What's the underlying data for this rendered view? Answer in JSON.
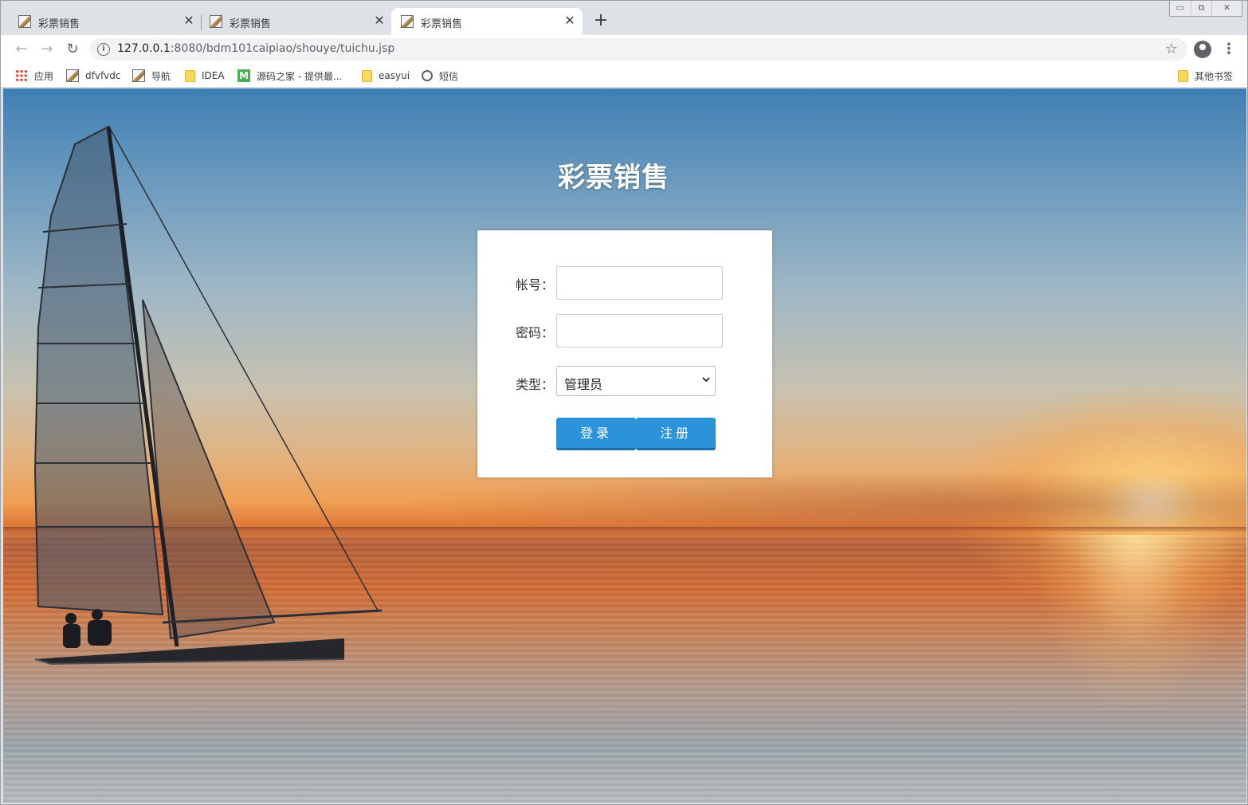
{
  "browser": {
    "tabs": [
      {
        "title": "彩票销售",
        "active": false
      },
      {
        "title": "彩票销售",
        "active": false
      },
      {
        "title": "彩票销售",
        "active": true
      }
    ],
    "url_host": "127.0.0.1",
    "url_path": ":8080/bdm101caipiao/shouye/tuichu.jsp",
    "bookmarks": [
      {
        "label": "应用",
        "icon": "apps-icon"
      },
      {
        "label": "dfvfvdc",
        "icon": "page-icon"
      },
      {
        "label": "导航",
        "icon": "page-icon"
      },
      {
        "label": "IDEA",
        "icon": "folder-icon"
      },
      {
        "label": "源码之家 - 提供最...",
        "icon": "m-logo-icon"
      },
      {
        "label": "easyui",
        "icon": "folder-icon"
      },
      {
        "label": "短信",
        "icon": "globe-icon"
      }
    ],
    "other_bookmarks": "其他书签"
  },
  "page": {
    "title": "彩票销售",
    "form": {
      "account_label": "帐号：",
      "account_value": "",
      "password_label": "密码：",
      "password_value": "",
      "type_label": "类型：",
      "type_selected": "管理员",
      "login_button": "登录",
      "register_button": "注册"
    }
  },
  "colors": {
    "button": "#2a93d9",
    "button_border": "#1e6fa8",
    "card_bg": "#ffffff"
  }
}
